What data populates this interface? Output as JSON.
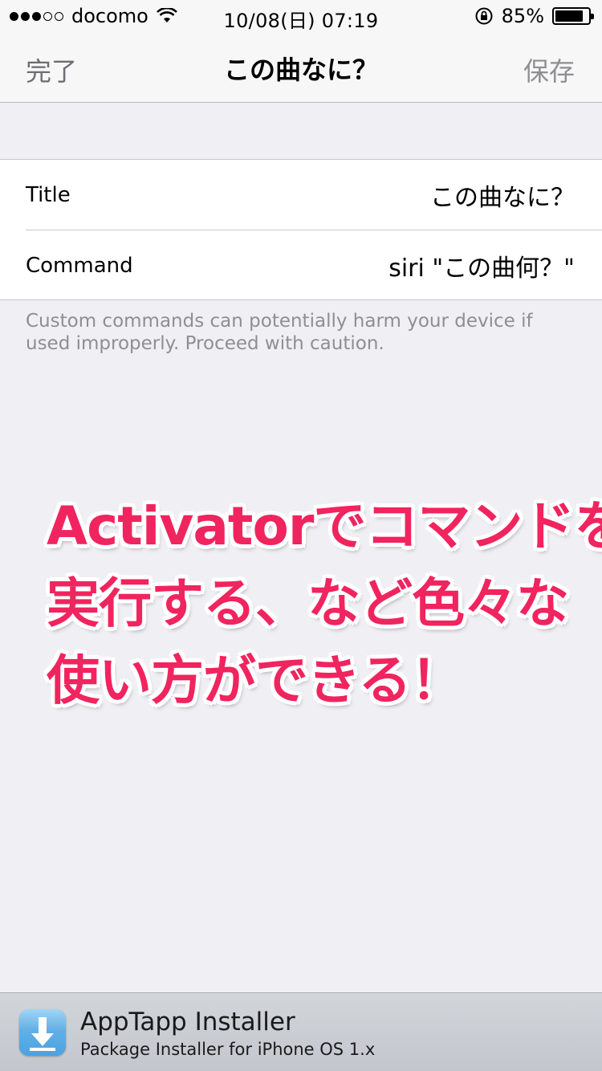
{
  "status_bar": {
    "carrier": "docomo",
    "datetime": "10/08(日) 07:19",
    "battery": "85%",
    "battery_level": 0.85,
    "signal_strength": 3,
    "signal_max": 5
  },
  "nav": {
    "left_label": "完了",
    "title": "この曲なに？",
    "right_label": "保存"
  },
  "form": {
    "rows": [
      {
        "label": "Title",
        "value": "この曲なに？"
      },
      {
        "label": "Command",
        "value": "siri \"この曲何？\""
      }
    ],
    "footnote": "Custom commands can potentially harm your device if used improperly. Proceed with caution."
  },
  "annotation": {
    "lines": [
      "Activatorでコマンドを",
      "実行する、など色々な",
      "使い方ができる！"
    ]
  },
  "banner": {
    "title": "AppTapp Installer",
    "subtitle": "Package Installer for iPhone OS 1.x",
    "icon": "download-arrow-icon"
  },
  "colors": {
    "accent_text": "#f0245e",
    "background": "#efeff4"
  }
}
